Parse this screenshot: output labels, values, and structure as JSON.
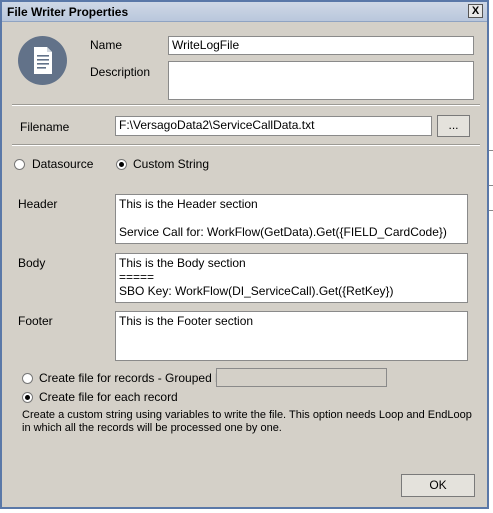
{
  "window": {
    "title": "File Writer Properties",
    "close_glyph": "X"
  },
  "icon": "document-icon",
  "name": {
    "label": "Name",
    "value": "WriteLogFile"
  },
  "description": {
    "label": "Description",
    "value": ""
  },
  "filename": {
    "label": "Filename",
    "value": "F:\\VersagoData2\\ServiceCallData.txt",
    "browse_label": "..."
  },
  "source": {
    "datasource_label": "Datasource",
    "custom_string_label": "Custom String",
    "selected": "custom_string"
  },
  "header": {
    "label": "Header",
    "value": "This is the Header section\n\nService Call for: WorkFlow(GetData).Get({FIELD_CardCode})"
  },
  "body": {
    "label": "Body",
    "value": "This is the Body section\n=====\nSBO Key: WorkFlow(DI_ServiceCall).Get({RetKey})"
  },
  "footer": {
    "label": "Footer",
    "value": "This is the Footer section"
  },
  "mode": {
    "grouped_label": "Create file for records - Grouped by",
    "grouped_value": "",
    "each_label": "Create file for each record",
    "selected": "each",
    "help_text": "Create a custom string using variables to write the file. This option needs Loop and EndLoop in which all the records will be processed one by one."
  },
  "ok_label": "OK"
}
